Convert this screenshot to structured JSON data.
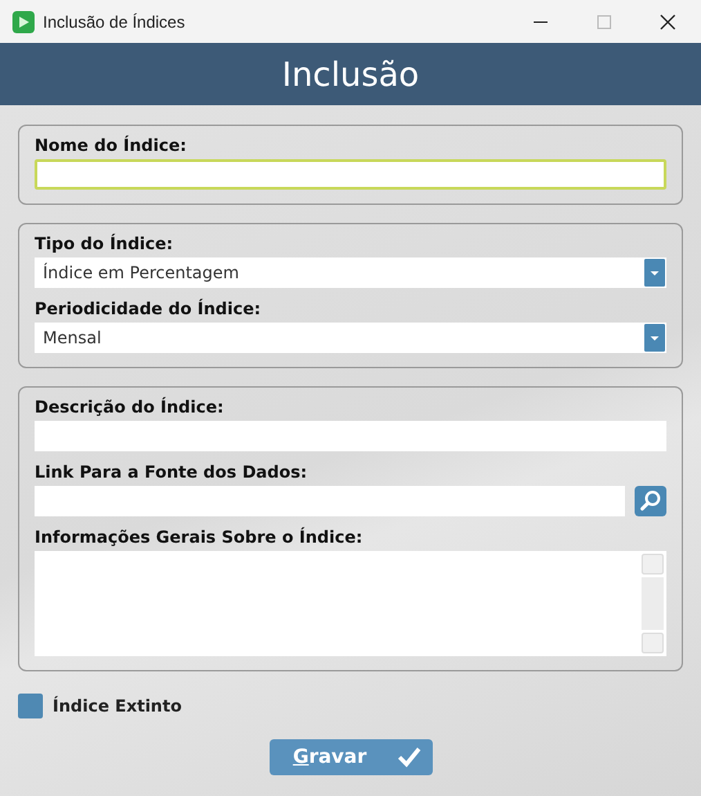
{
  "window": {
    "title": "Inclusão de Índices"
  },
  "header": {
    "title": "Inclusão"
  },
  "groups": [
    {
      "fields": [
        {
          "kind": "text",
          "label": "Nome do Índice:",
          "focused": true
        }
      ]
    },
    {
      "fields": [
        {
          "kind": "select",
          "label": "Tipo do Índice:",
          "value": "Índice em Percentagem",
          "focused": false
        },
        {
          "kind": "select",
          "label": "Periodicidade do Índice:",
          "value": "Mensal",
          "focused": false
        }
      ]
    },
    {
      "fields": [
        {
          "kind": "text",
          "label": "Descrição do Índice:",
          "focused": false
        },
        {
          "kind": "search",
          "label": "Link Para a Fonte dos Dados:",
          "focused": false
        },
        {
          "kind": "textarea",
          "label": "Informações Gerais Sobre o Índice:",
          "focused": false
        }
      ]
    }
  ],
  "checkbox": {
    "label": "Índice Extinto",
    "checked": false
  },
  "save_button": {
    "label": "Gravar"
  }
}
